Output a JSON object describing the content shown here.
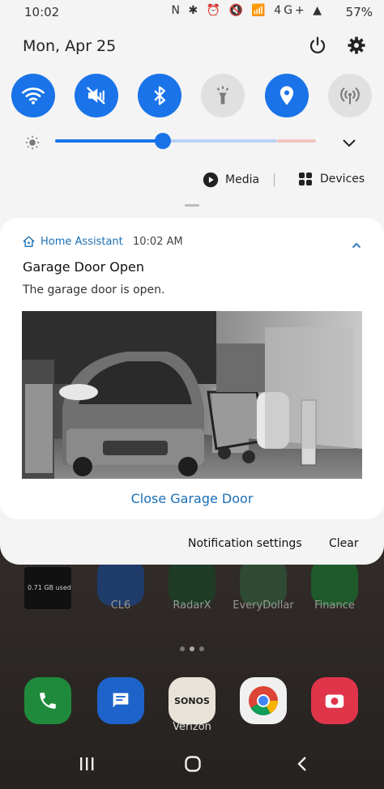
{
  "status_bar": {
    "time": "10:02",
    "icons": "N ✱ ⏰ 🔇 📶 4G+ ▲",
    "battery": "57%"
  },
  "shade": {
    "date": "Mon, Apr 25",
    "quick_settings": [
      {
        "name": "wifi",
        "on": true
      },
      {
        "name": "mute",
        "on": true
      },
      {
        "name": "bluetooth",
        "on": true
      },
      {
        "name": "flashlight",
        "on": false
      },
      {
        "name": "location",
        "on": true
      },
      {
        "name": "mobile-hotspot",
        "on": false
      }
    ],
    "brightness_fraction": 0.5,
    "media_label": "Media",
    "devices_label": "Devices"
  },
  "notification": {
    "app_name": "Home Assistant",
    "time": "10:02 AM",
    "title": "Garage Door Open",
    "body": "The garage door is open.",
    "action": "Close Garage Door"
  },
  "footer": {
    "settings_label": "Notification settings",
    "clear_label": "Clear"
  },
  "homescreen": {
    "widget_text": "0.71 GB used",
    "apps": [
      "CL6",
      "RadarX",
      "EveryDollar",
      "Finance"
    ],
    "dock_label": "Verizon",
    "dock_sonos": "SONOS"
  },
  "colors": {
    "accent": "#1a73e8",
    "link": "#1a6fb5",
    "shade_bg": "#f4f4f4"
  }
}
